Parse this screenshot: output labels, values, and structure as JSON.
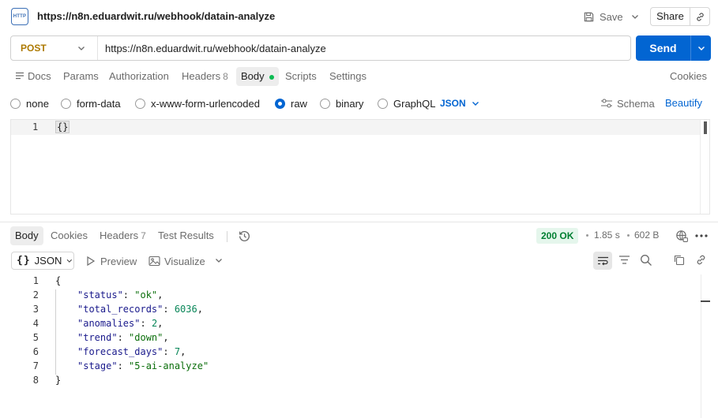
{
  "title": {
    "icon_text": "HTTP",
    "url": "https://n8n.eduardwit.ru/webhook/datain-analyze",
    "save_label": "Save",
    "share_label": "Share"
  },
  "request": {
    "method": "POST",
    "url": "https://n8n.eduardwit.ru/webhook/datain-analyze",
    "send_label": "Send",
    "tabs": [
      {
        "label": "Docs"
      },
      {
        "label": "Params"
      },
      {
        "label": "Authorization"
      },
      {
        "label": "Headers",
        "count": "8"
      },
      {
        "label": "Body"
      },
      {
        "label": "Scripts"
      },
      {
        "label": "Settings"
      }
    ],
    "cookies_label": "Cookies",
    "body_types": [
      "none",
      "form-data",
      "x-www-form-urlencoded",
      "raw",
      "binary",
      "GraphQL"
    ],
    "selected_body_type": "raw",
    "language": "JSON",
    "schema_label": "Schema",
    "beautify_label": "Beautify",
    "editor": {
      "line_number": "1",
      "code": "{}"
    }
  },
  "response": {
    "tabs": [
      {
        "label": "Body"
      },
      {
        "label": "Cookies"
      },
      {
        "label": "Headers",
        "count": "7"
      },
      {
        "label": "Test Results"
      }
    ],
    "status": "200 OK",
    "time": "1.85 s",
    "size": "602 B",
    "format": "JSON",
    "preview_label": "Preview",
    "visualize_label": "Visualize",
    "lines": [
      {
        "n": "1",
        "text": "{"
      },
      {
        "n": "2",
        "key": "\"status\"",
        "value": "\"ok\"",
        "type": "str"
      },
      {
        "n": "3",
        "key": "\"total_records\"",
        "value": "6036",
        "type": "num"
      },
      {
        "n": "4",
        "key": "\"anomalies\"",
        "value": "2",
        "type": "num"
      },
      {
        "n": "5",
        "key": "\"trend\"",
        "value": "\"down\"",
        "type": "str"
      },
      {
        "n": "6",
        "key": "\"forecast_days\"",
        "value": "7",
        "type": "num"
      },
      {
        "n": "7",
        "key": "\"stage\"",
        "value": "\"5-ai-analyze\"",
        "type": "str",
        "last": true
      },
      {
        "n": "8",
        "text": "}"
      }
    ]
  },
  "colors": {
    "accent": "#0265d2",
    "method": "#ad7a03",
    "status_ok": "#007f31",
    "body_dot": "#0cbb52"
  }
}
